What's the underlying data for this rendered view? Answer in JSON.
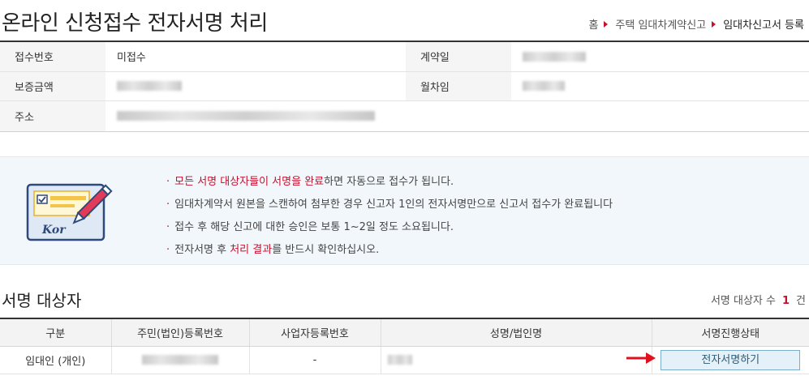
{
  "header": {
    "title": "온라인 신청접수 전자서명 처리",
    "breadcrumb": [
      "홈",
      "주택 임대차계약신고",
      "임대차신고서 등록"
    ]
  },
  "info": {
    "receipt_no_label": "접수번호",
    "receipt_no_value": "미접수",
    "contract_date_label": "계약일",
    "deposit_label": "보증금액",
    "monthly_rent_label": "월차임",
    "address_label": "주소"
  },
  "notice": {
    "illustration_text": "Kor",
    "line1_highlight": "모든 서명 대상자들이 서명을 완료",
    "line1_rest": "하면 자동으로 접수가 됩니다.",
    "line2": "임대차계약서 원본을 스캔하여 첨부한 경우 신고자 1인의 전자서명만으로 신고서 접수가 완료됩니다",
    "line3": "접수 후 해당 신고에 대한 승인은 보통 1~2일 정도 소요됩니다.",
    "line4_pre": "전자서명 후 ",
    "line4_highlight": "처리 결과",
    "line4_post": "를 반드시 확인하십시오."
  },
  "signers": {
    "title": "서명 대상자",
    "count_label": "서명 대상자 수",
    "count": "1",
    "count_unit": "건",
    "columns": [
      "구분",
      "주민(법인)등록번호",
      "사업자등록번호",
      "성명/법인명",
      "서명진행상태"
    ],
    "rows": [
      {
        "type": "임대인 (개인)",
        "business_no": "-",
        "action": "전자서명하기"
      }
    ]
  },
  "colors": {
    "accent_red": "#c8102e",
    "button_bg": "#e4f1f8",
    "notice_bg": "#f1f7fb"
  }
}
